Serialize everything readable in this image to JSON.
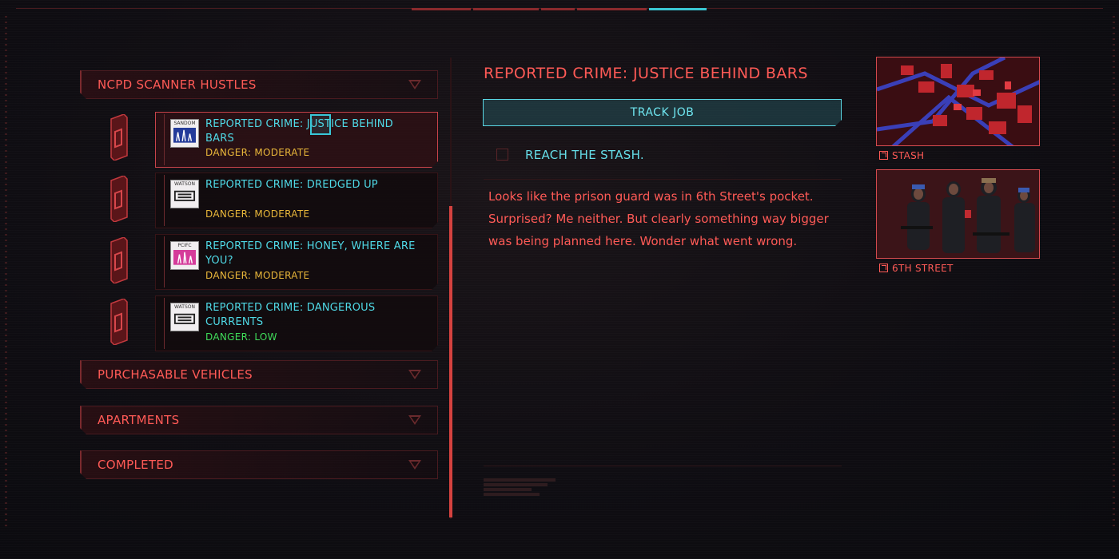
{
  "accent": {
    "red": "#ff5a56",
    "cyan": "#4fd9e6",
    "moderate": "#e8b63a",
    "low": "#3fdc5a"
  },
  "categories": {
    "ncpd": {
      "label": "NCPD SCANNER HUSTLES",
      "icon": "chevron-down-icon"
    },
    "vehicles": {
      "label": "PURCHASABLE VEHICLES",
      "icon": "chevron-down-icon"
    },
    "apartments": {
      "label": "APARTMENTS",
      "icon": "chevron-down-icon"
    },
    "completed": {
      "label": "COMPLETED",
      "icon": "chevron-down-icon"
    }
  },
  "entries": [
    {
      "title": "REPORTED CRIME: JUSTICE BEHIND BARS",
      "danger": "DANGER: MODERATE",
      "district": "SANDOM",
      "selected": true
    },
    {
      "title": "REPORTED CRIME: DREDGED UP",
      "danger": "DANGER: MODERATE",
      "district": "WATSON",
      "selected": false
    },
    {
      "title": "REPORTED CRIME: HONEY, WHERE ARE YOU?",
      "danger": "DANGER: MODERATE",
      "district": "PCIFC",
      "selected": false
    },
    {
      "title": "REPORTED CRIME: DANGEROUS CURRENTS",
      "danger": "DANGER: LOW",
      "district": "WATSON",
      "selected": false
    }
  ],
  "detail": {
    "title": "REPORTED CRIME: JUSTICE BEHIND BARS",
    "track_button": "TRACK JOB",
    "objective": "REACH THE STASH.",
    "description": "Looks like the prison guard was in 6th Street's pocket. Surprised? Me neither. But clearly something way bigger was being planned here. Wonder what went wrong."
  },
  "side_images": [
    {
      "label": "STASH",
      "icon": "external-link-icon",
      "kind": "map"
    },
    {
      "label": "6TH STREET",
      "icon": "external-link-icon",
      "kind": "gang"
    }
  ]
}
